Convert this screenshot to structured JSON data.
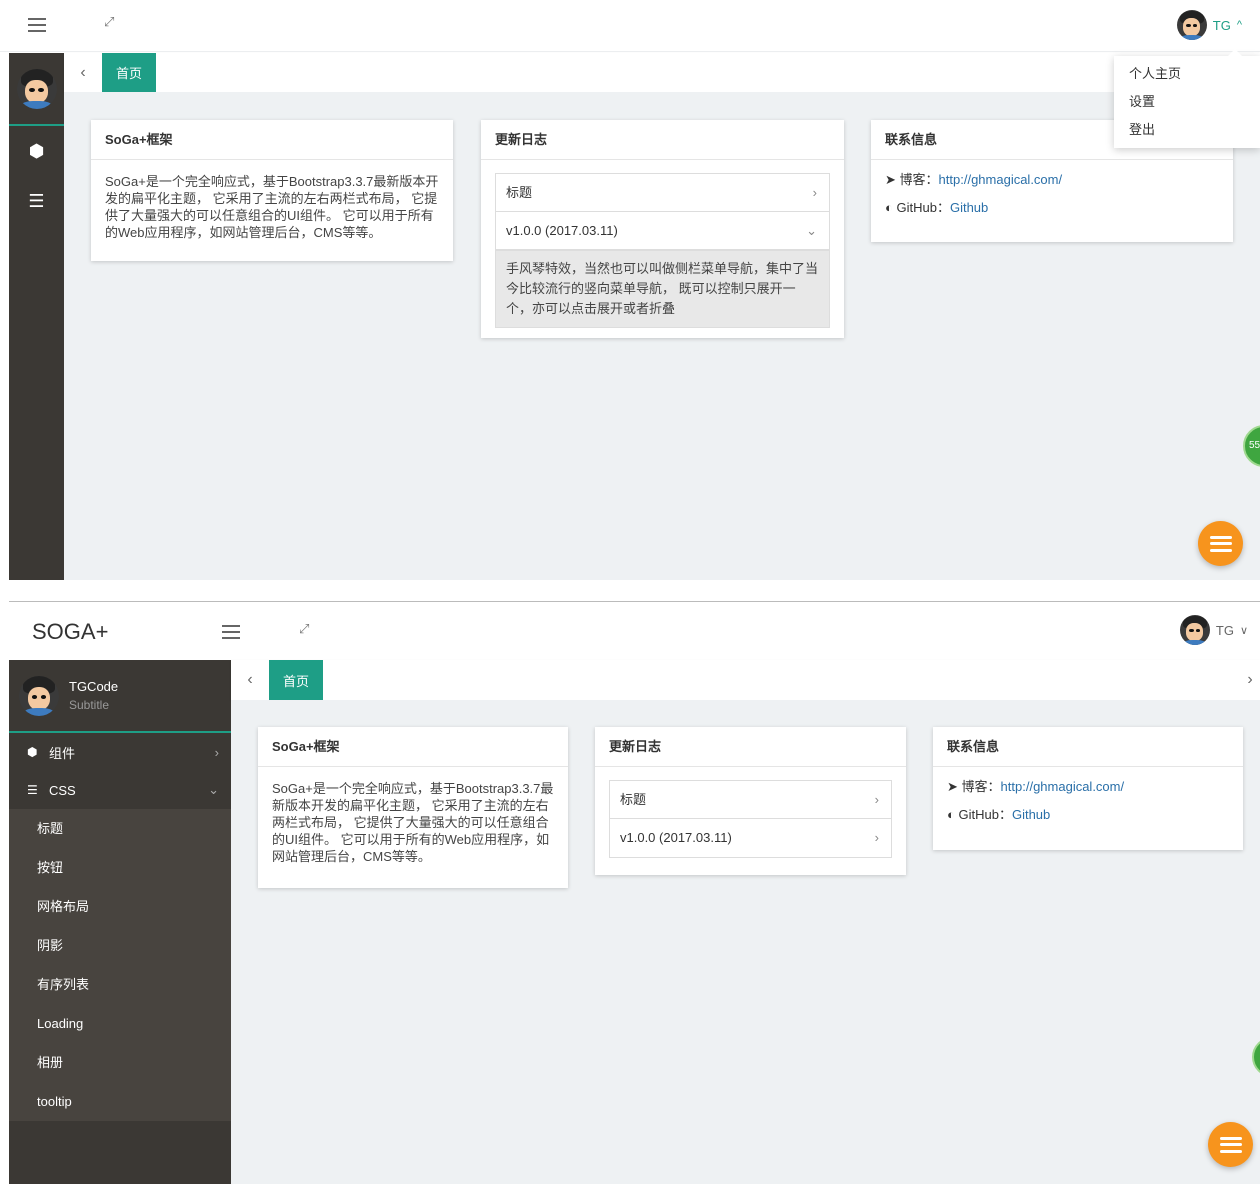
{
  "user": {
    "name": "TG",
    "caret_open": "^",
    "caret_closed": "∨"
  },
  "dropdown": {
    "items": [
      "个人主页",
      "设置",
      "登出"
    ]
  },
  "brand": {
    "logo": "SOGA+"
  },
  "profile": {
    "name": "TGCode",
    "subtitle": "Subtitle"
  },
  "sidebar": {
    "groups": [
      {
        "label": "组件",
        "icon": "cube-icon",
        "glyph": "⬢"
      },
      {
        "label": "CSS",
        "icon": "css3-icon",
        "glyph": "☰"
      }
    ],
    "css_items": [
      "标题",
      "按钮",
      "网格布局",
      "阴影",
      "有序列表",
      "Loading",
      "相册",
      "tooltip"
    ]
  },
  "tabs": {
    "active": "首页"
  },
  "cards": {
    "framework": {
      "title": "SoGa+框架",
      "body": "SoGa+是一个完全响应式，基于Bootstrap3.3.7最新版本开发的扁平化主题， 它采用了主流的左右两栏式布局， 它提供了大量强大的可以任意组合的UI组件。 它可以用于所有的Web应用程序，如网站管理后台，CMS等等。"
    },
    "changelog": {
      "title": "更新日志",
      "rows": [
        "标题",
        "v1.0.0 (2017.03.11)"
      ],
      "panel": "手风琴特效，当然也可以叫做侧栏菜单导航，集中了当今比较流行的竖向菜单导航， 既可以控制只展开一个，亦可以点击展开或者折叠"
    },
    "contact": {
      "title": "联系信息",
      "blog_label": "博客：",
      "blog_url": "http://ghmagical.com/",
      "github_label": "GitHub：",
      "github_link": "Github"
    }
  },
  "colors": {
    "accent": "#1e9e86",
    "sidebar": "#3b3834",
    "fab": "#f7941d"
  },
  "badge": {
    "text": "55"
  }
}
